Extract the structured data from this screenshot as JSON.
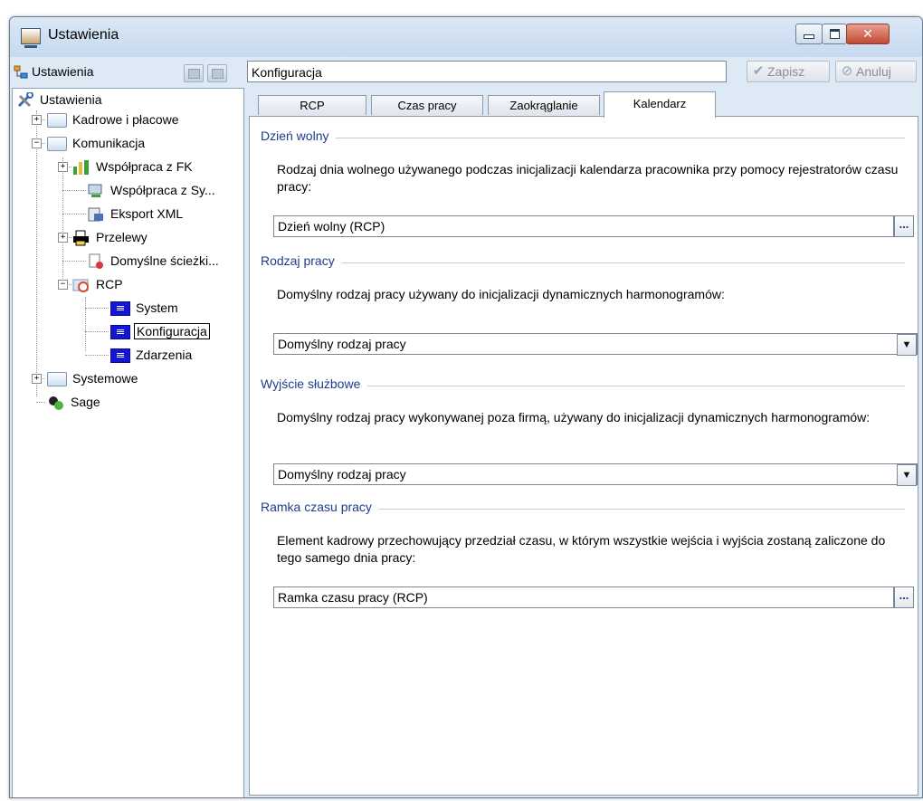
{
  "window": {
    "title": "Ustawienia",
    "controls": {
      "minimize": "minimize",
      "maximize": "maximize",
      "close": "✕"
    }
  },
  "left_panel": {
    "header_label": "Ustawienia",
    "tree": {
      "root": "Ustawienia",
      "nodes": [
        {
          "label": "Kadrowe i płacowe",
          "expander": "+"
        },
        {
          "label": "Komunikacja",
          "expander": "−"
        },
        {
          "label": "Współpraca z FK",
          "expander": "+"
        },
        {
          "label": "Współpraca z Sy..."
        },
        {
          "label": "Eksport XML"
        },
        {
          "label": "Przelewy",
          "expander": "+"
        },
        {
          "label": "Domyślne ścieżki..."
        },
        {
          "label": "RCP",
          "expander": "−"
        },
        {
          "label": "System"
        },
        {
          "label": "Konfiguracja",
          "selected": true
        },
        {
          "label": "Zdarzenia"
        },
        {
          "label": "Systemowe",
          "expander": "+"
        },
        {
          "label": "Sage"
        }
      ]
    }
  },
  "right_panel": {
    "config_name": "Konfiguracja",
    "save_label": "Zapisz",
    "cancel_label": "Anuluj",
    "tabs": [
      {
        "label": "RCP"
      },
      {
        "label": "Czas pracy"
      },
      {
        "label": "Zaokrąglanie"
      },
      {
        "label": "Kalendarz",
        "active": true
      }
    ],
    "sections": [
      {
        "title": "Dzień wolny",
        "description": "Rodzaj dnia wolnego używanego podczas inicjalizacji kalendarza pracownika przy pomocy rejestratorów czasu pracy:",
        "value": "Dzień wolny (RCP)",
        "control": "ellipsis"
      },
      {
        "title": "Rodzaj pracy",
        "description": "Domyślny rodzaj pracy używany do inicjalizacji dynamicznych harmonogramów:",
        "value": "Domyślny rodzaj pracy",
        "control": "dropdown"
      },
      {
        "title": "Wyjście służbowe",
        "description": "Domyślny rodzaj pracy wykonywanej poza firmą, używany do inicjalizacji dynamicznych harmonogramów:",
        "value": "Domyślny rodzaj pracy",
        "control": "dropdown"
      },
      {
        "title": "Ramka czasu pracy",
        "description": "Element kadrowy przechowujący przedział czasu, w którym wszystkie wejścia i wyjścia zostaną zaliczone do tego samego dnia pracy:",
        "value": "Ramka czasu pracy (RCP)",
        "control": "ellipsis"
      }
    ],
    "ellipsis_glyph": "...",
    "dropdown_glyph": "▼"
  },
  "colors": {
    "section_title": "#1e3c8c",
    "window_bg": "#dde9f5",
    "close_button": "#c24a33",
    "selected_doc_icon": "#1515d6"
  }
}
